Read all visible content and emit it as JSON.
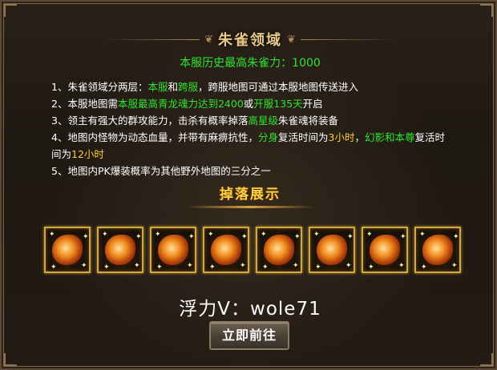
{
  "header": {
    "title": "朱雀领域",
    "record": "本服历史最高朱雀力：1000"
  },
  "rules": [
    {
      "parts": [
        {
          "text": "1、朱雀领域分两层：",
          "color": "white"
        },
        {
          "text": "本服",
          "color": "green"
        },
        {
          "text": "和",
          "color": "white"
        },
        {
          "text": "跨服",
          "color": "green"
        },
        {
          "text": "，跨服地图可通过本服地图传送进入",
          "color": "white"
        }
      ]
    },
    {
      "parts": [
        {
          "text": "2、本服地图需",
          "color": "white"
        },
        {
          "text": "本服最高青龙魂力达到2400",
          "color": "green"
        },
        {
          "text": "或",
          "color": "white"
        },
        {
          "text": "开服135天",
          "color": "green"
        },
        {
          "text": "开启",
          "color": "white"
        }
      ]
    },
    {
      "parts": [
        {
          "text": "3、领主有强大的群攻能力，击杀有概率掉落",
          "color": "white"
        },
        {
          "text": "高星级",
          "color": "green"
        },
        {
          "text": "朱雀魂将装备",
          "color": "white"
        }
      ]
    },
    {
      "parts": [
        {
          "text": "4、地图内怪物为动态血量，并带有麻痹抗性，",
          "color": "white"
        },
        {
          "text": "分身",
          "color": "green"
        },
        {
          "text": "复活时间为",
          "color": "white"
        },
        {
          "text": "3小时",
          "color": "yellow"
        },
        {
          "text": "，",
          "color": "white"
        },
        {
          "text": "幻影和本尊",
          "color": "green"
        },
        {
          "text": "复活时间为",
          "color": "white"
        },
        {
          "text": "12小时",
          "color": "yellow"
        }
      ]
    },
    {
      "parts": [
        {
          "text": "5、地图内PK爆装概率为其他野外地图的三分之一",
          "color": "white"
        }
      ]
    }
  ],
  "drops": {
    "title": "掉落展示",
    "items": [
      {
        "icon": "gauntlet-icon"
      },
      {
        "icon": "armor-icon"
      },
      {
        "icon": "ring-icon"
      },
      {
        "icon": "bracer-icon"
      },
      {
        "icon": "helmet-icon"
      },
      {
        "icon": "boots-icon"
      },
      {
        "icon": "belt-icon"
      },
      {
        "icon": "crown-icon"
      }
    ]
  },
  "watermark": "浮力V：wole71",
  "action": {
    "go_label": "立即前往"
  },
  "colors": {
    "green": "#2ee52e",
    "yellow": "#ffcc33",
    "white": "#ffffff",
    "title": "#e8c98a",
    "drop_title": "#ffd040",
    "frame": "#d3a93d"
  }
}
